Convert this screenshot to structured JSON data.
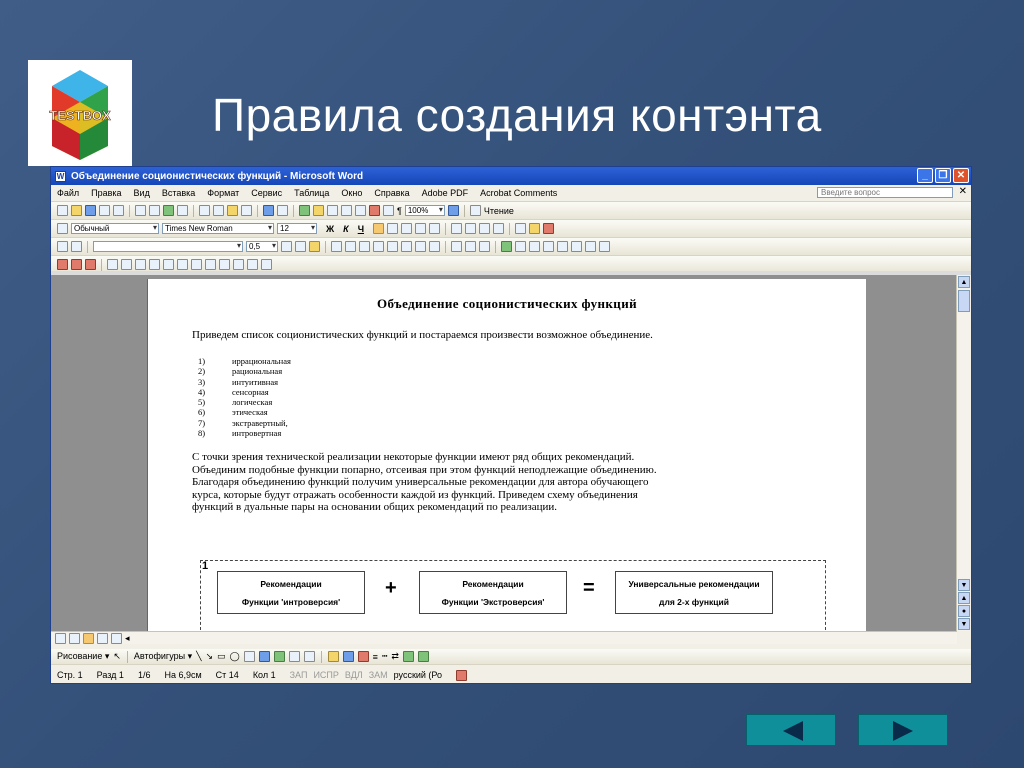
{
  "slide": {
    "title": "Правила создания контэнта",
    "logo_text": "TESTBOX",
    "nav_prev_icon": "triangle-left-icon",
    "nav_next_icon": "triangle-right-icon"
  },
  "window": {
    "title": "Объединение соционистических функций - Microsoft Word"
  },
  "menu": {
    "items": [
      "Файл",
      "Правка",
      "Вид",
      "Вставка",
      "Формат",
      "Сервис",
      "Таблица",
      "Окно",
      "Справка",
      "Adobe PDF",
      "Acrobat Comments"
    ],
    "help_placeholder": "Введите вопрос"
  },
  "toolbar": {
    "zoom": "100%",
    "reading": "Чтение",
    "style": "Обычный",
    "font": "Times New Roman",
    "size": "12",
    "bold": "Ж",
    "italic": "К",
    "underline": "Ч",
    "line_weight": "0,5"
  },
  "document": {
    "title": "Объединение соционистических функций",
    "intro": "Приведем список соционистических функций и постараемся произвести возможное объединение.",
    "list": [
      {
        "num": "1)",
        "text": "иррациональная"
      },
      {
        "num": "2)",
        "text": "рациональная"
      },
      {
        "num": "3)",
        "text": "интуитивная"
      },
      {
        "num": "4)",
        "text": "сенсорная"
      },
      {
        "num": "5)",
        "text": "логическая"
      },
      {
        "num": "6)",
        "text": "этическая"
      },
      {
        "num": "7)",
        "text": "экстравертный,"
      },
      {
        "num": "8)",
        "text": "интровертная"
      }
    ],
    "paragraph_lines": [
      "С точки зрения технической реализации некоторые функции имеют ряд общих рекомендаций.",
      "Объединим  подобные функции попарно, отсеивая при этом  функций неподлежащие объединению.",
      "Благодаря объединению функций получим универсальные рекомендации для автора обучающего",
      "курса, которые будут отражать особенности каждой из функций. Приведем схему объединения",
      "функций в дуальные пары на основании общих рекомендаций по реализации."
    ],
    "scheme": {
      "number": "1",
      "box1": {
        "line1": "Рекомендации",
        "line2": "Функции 'интроверсия'"
      },
      "plus": "+",
      "box2": {
        "line1": "Рекомендации",
        "line2": "Функции 'Экстроверсия'"
      },
      "equals": "=",
      "box3": {
        "line1": "Универсальные рекомендации",
        "line2": "для  2-х функций"
      }
    }
  },
  "drawing_bar": {
    "draw": "Рисование ▾",
    "autoshapes": "Автофигуры ▾"
  },
  "status": {
    "page": "Стр. 1",
    "section": "Разд 1",
    "pages": "1/6",
    "at": "На 6,9см",
    "line": "Ст 14",
    "col": "Кол 1",
    "rec": "ЗАП",
    "trk": "ИСПР",
    "ext": "ВДЛ",
    "ovr": "ЗАМ",
    "lang": "русский (Ро"
  }
}
